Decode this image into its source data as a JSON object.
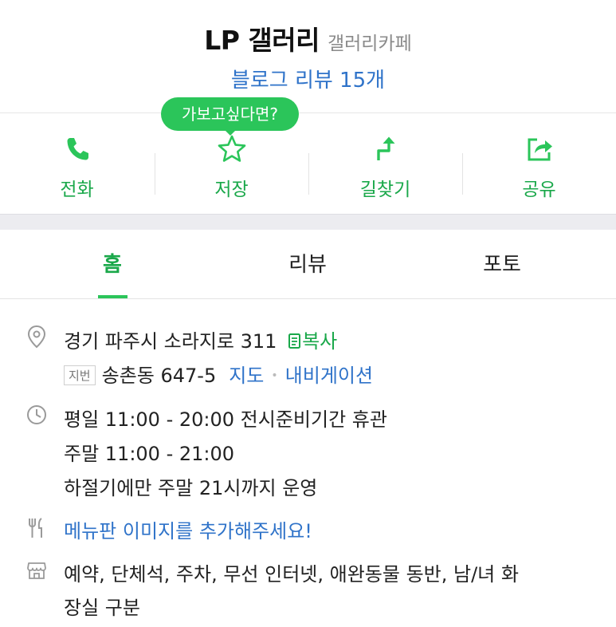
{
  "place": {
    "name": "LP 갤러리",
    "category": "갤러리카페",
    "review_link": "블로그 리뷰 15개"
  },
  "promo_bubble": "가보고싶다면?",
  "actions": [
    {
      "label": "전화",
      "icon": "phone-icon"
    },
    {
      "label": "저장",
      "icon": "star-icon"
    },
    {
      "label": "길찾기",
      "icon": "directions-icon"
    },
    {
      "label": "공유",
      "icon": "share-icon"
    }
  ],
  "tabs": {
    "home": "홈",
    "review": "리뷰",
    "photo": "포토",
    "active": "home"
  },
  "address": {
    "road": "경기 파주시 소라지로 311",
    "copy_label": "복사",
    "jibun_chip": "지번",
    "jibun": "송촌동 647-5",
    "map_link": "지도",
    "separator": "•",
    "navigation_link": "내비게이션"
  },
  "hours": {
    "line1": "평일 11:00 - 20:00 전시준비기간 휴관",
    "line2": "주말 11:00 - 21:00",
    "line3": "하절기에만 주말 21시까지 운영"
  },
  "menu": {
    "add_image_link": "메뉴판 이미지를 추가해주세요!"
  },
  "amenities": {
    "line1": "예약, 단체석, 주차, 무선 인터넷, 애완동물 동반, 남/녀 화",
    "line2": "장실 구분"
  },
  "colors": {
    "accent_green": "#2bc55a",
    "label_green": "#1aa84a",
    "link_blue": "#2f73c9",
    "icon_gray": "#9a9a9a"
  }
}
